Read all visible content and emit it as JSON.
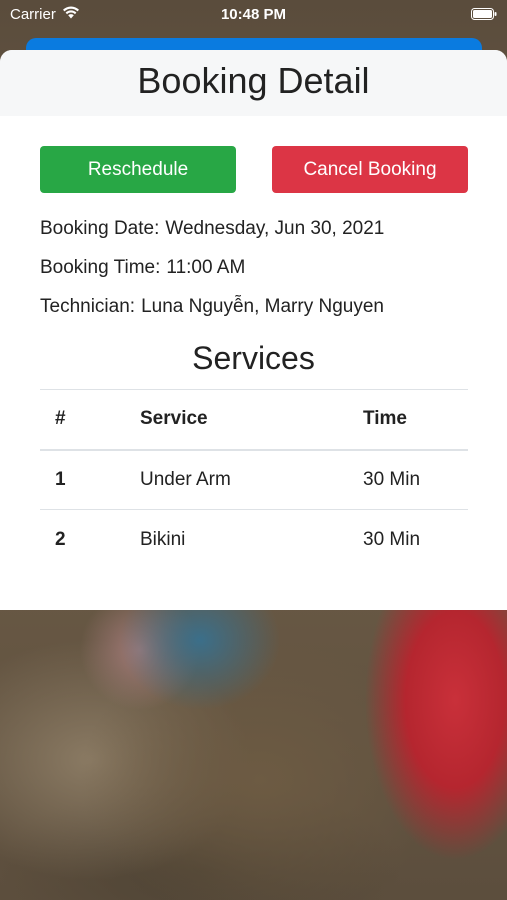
{
  "status_bar": {
    "carrier": "Carrier",
    "time": "10:48 PM"
  },
  "header": {
    "title": "Booking Detail"
  },
  "actions": {
    "reschedule_label": "Reschedule",
    "cancel_label": "Cancel Booking"
  },
  "booking": {
    "date_label": "Booking Date:",
    "date_value": "Wednesday, Jun 30, 2021",
    "time_label": "Booking Time:",
    "time_value": "11:00 AM",
    "technician_label": "Technician:",
    "technician_value": "Luna Nguyễn, Marry Nguyen"
  },
  "services": {
    "title": "Services",
    "columns": [
      "#",
      "Service",
      "Time"
    ],
    "rows": [
      {
        "num": "1",
        "service": "Under Arm",
        "time": "30 Min"
      },
      {
        "num": "2",
        "service": "Bikini",
        "time": "30 Min"
      }
    ]
  },
  "colors": {
    "reschedule": "#28a745",
    "cancel": "#dc3545",
    "strip": "#0a7be0"
  }
}
